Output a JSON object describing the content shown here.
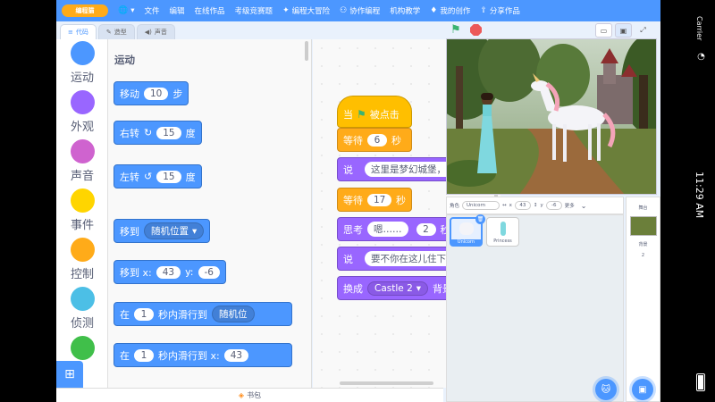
{
  "menubar": {
    "logo": "编程猫",
    "items": [
      {
        "icon": "globe-icon",
        "label": "▾"
      },
      {
        "icon": "",
        "label": "文件"
      },
      {
        "icon": "",
        "label": "编辑"
      },
      {
        "icon": "",
        "label": "在线作品"
      },
      {
        "icon": "",
        "label": "考级竞赛题"
      },
      {
        "icon": "",
        "label": "编程大冒险"
      },
      {
        "icon": "",
        "label": "协作编程"
      },
      {
        "icon": "",
        "label": "机构教学"
      },
      {
        "icon": "",
        "label": "我的创作"
      },
      {
        "icon": "",
        "label": "分享作品"
      }
    ]
  },
  "tabs": [
    {
      "label": "代码",
      "icon": "code-icon"
    },
    {
      "label": "造型",
      "icon": "brush-icon"
    },
    {
      "label": "声音",
      "icon": "speaker-icon"
    }
  ],
  "categories": [
    {
      "label": "运动",
      "color": "#4c97ff"
    },
    {
      "label": "外观",
      "color": "#9966ff"
    },
    {
      "label": "声音",
      "color": "#cf63cf"
    },
    {
      "label": "事件",
      "color": "#ffd500"
    },
    {
      "label": "控制",
      "color": "#ffab19"
    },
    {
      "label": "侦测",
      "color": "#4cbfe6"
    },
    {
      "label": "",
      "color": "#40bf4a"
    }
  ],
  "palette": {
    "title": "运动",
    "move": {
      "label": "移动",
      "value": "10",
      "unit": "步"
    },
    "turn_right": {
      "label": "右转",
      "value": "15",
      "unit": "度"
    },
    "turn_left": {
      "label": "左转",
      "value": "15",
      "unit": "度"
    },
    "goto": {
      "label": "移到",
      "option": "随机位置"
    },
    "goto_xy": {
      "label": "移到 x:",
      "x": "43",
      "ylabel": "y:",
      "y": "-6"
    },
    "glide_random": {
      "label": "在",
      "value": "1",
      "text": "秒内滑行到",
      "option": "随机位"
    },
    "glide_xy": {
      "label": "在",
      "value": "1",
      "text": "秒内滑行到 x:",
      "x": "43"
    }
  },
  "script": {
    "hat": {
      "label_before": "当",
      "label_after": "被点击"
    },
    "wait1": {
      "label": "等待",
      "value": "6",
      "unit": "秒"
    },
    "say1": {
      "label": "说",
      "value": "这里是梦幻城堡，你是谁啊?"
    },
    "wait2": {
      "label": "等待",
      "value": "17",
      "unit": "秒"
    },
    "think": {
      "label": "思考",
      "value": "嗯……",
      "secs": "2",
      "unit": "秒"
    },
    "say2": {
      "label": "说",
      "value": "要不你在这儿住下吧?"
    },
    "switch": {
      "label": "换成",
      "option": "Castle 2",
      "unit": "背景"
    }
  },
  "backpack": {
    "label": "书包"
  },
  "sprite_info": {
    "name_label": "角色",
    "name": "Unicorn",
    "x": "43",
    "y": "-6",
    "show_label": "显示",
    "more": "更多"
  },
  "sprites": [
    {
      "name": "Unicorn",
      "selected": true
    },
    {
      "name": "Princess",
      "selected": false
    }
  ],
  "stage_panel": {
    "title": "舞台",
    "backdrop_label": "背景",
    "backdrop_count": "2"
  },
  "status_bar": {
    "carrier": "Carrier",
    "time": "11:29 AM"
  }
}
